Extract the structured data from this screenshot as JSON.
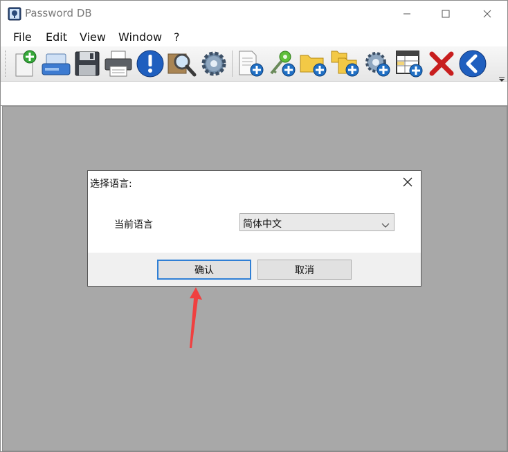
{
  "window": {
    "title": "Password DB",
    "controls": {
      "minimize": "minimize-icon",
      "maximize": "maximize-icon",
      "close": "close-icon"
    }
  },
  "menu": [
    {
      "label": "File"
    },
    {
      "label": "Edit"
    },
    {
      "label": "View"
    },
    {
      "label": "Window"
    },
    {
      "label": "?"
    }
  ],
  "toolbar": {
    "icons": [
      "new-database-icon",
      "drive-icon",
      "save-icon",
      "print-icon",
      "info-icon",
      "search-icon",
      "settings-icon",
      "add-entry-icon",
      "add-key-icon",
      "add-folder-icon",
      "add-subfolder-icon",
      "add-setting-icon",
      "add-table-icon",
      "delete-icon",
      "back-icon"
    ]
  },
  "dialog": {
    "title": "选择语言:",
    "label": "当前语言",
    "select_value": "简体中文",
    "ok_label": "确认",
    "cancel_label": "取消"
  },
  "colors": {
    "workspace": "#a8a8a8",
    "ok_border": "#2f7fd5",
    "annotation_arrow": "#f04040"
  }
}
